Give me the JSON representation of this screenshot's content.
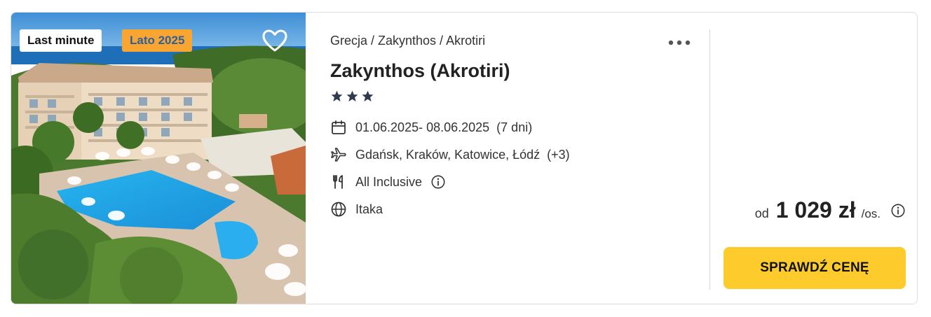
{
  "offer": {
    "badges": {
      "last_minute": "Last minute",
      "season": "Lato 2025"
    },
    "breadcrumb": "Grecja / Zakynthos / Akrotiri",
    "title": "Zakynthos (Akrotiri)",
    "stars": 3,
    "dates": "01.06.2025- 08.06.2025",
    "duration": "(7 dni)",
    "airports": "Gdańsk, Kraków, Katowice, Łódź",
    "airports_more": "(+3)",
    "board": "All Inclusive",
    "operator": "Itaka",
    "price": {
      "prefix": "od",
      "value": "1 029 zł",
      "unit": "/os."
    },
    "cta_label": "SPRAWDŹ CENĘ"
  },
  "colors": {
    "cta": "#fdcb2c",
    "season_badge_bg": "#f8a631",
    "season_badge_text": "#2c5f9e",
    "stars": "#2f3a4d"
  },
  "icons": {
    "favorite": "heart-outline-icon",
    "more": "more-dots-icon",
    "dates": "calendar-icon",
    "airports": "plane-icon",
    "board": "cutlery-icon",
    "operator": "globe-icon",
    "info": "info-icon",
    "star": "star-icon"
  }
}
